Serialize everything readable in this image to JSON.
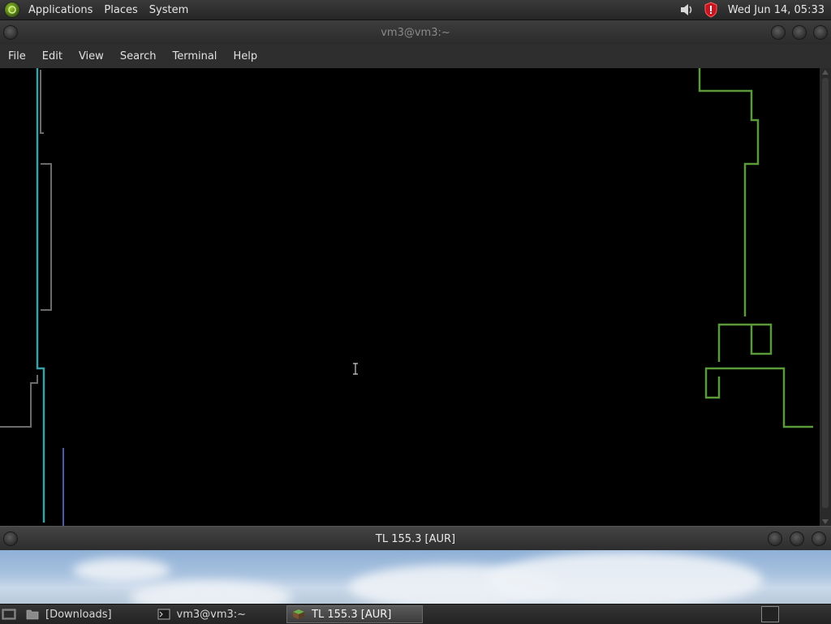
{
  "top_panel": {
    "menu": [
      "Applications",
      "Places",
      "System"
    ],
    "clock": "Wed Jun 14, 05:33"
  },
  "terminal": {
    "title": "vm3@vm3:~",
    "menu": [
      "File",
      "Edit",
      "View",
      "Search",
      "Terminal",
      "Help"
    ]
  },
  "game_window": {
    "title": "TL 155.3 [AUR]"
  },
  "taskbar": {
    "items": [
      {
        "label": "[Downloads]",
        "icon": "folder-icon",
        "active": false
      },
      {
        "label": "vm3@vm3:~",
        "icon": "terminal-icon",
        "active": false
      },
      {
        "label": "TL 155.3 [AUR]",
        "icon": "game-cube-icon",
        "active": true
      }
    ]
  },
  "colors": {
    "cyan_line": "#3aa0a8",
    "green_line": "#5a9a3a",
    "gray_line": "#6b6b6b",
    "blue_line": "#4a5aa8",
    "terminal_bg": "#000000"
  }
}
